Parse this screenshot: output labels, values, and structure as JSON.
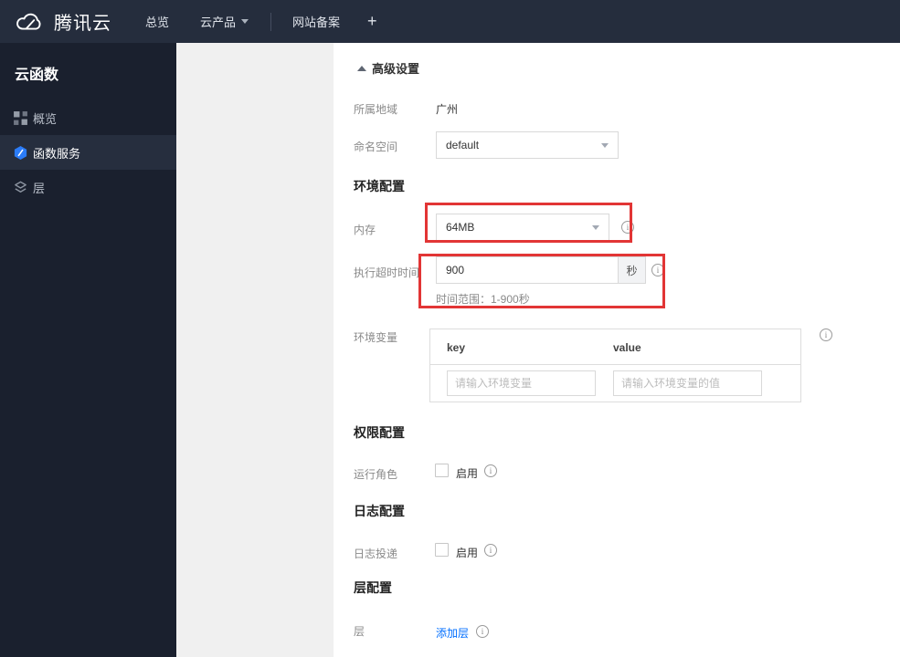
{
  "navbar": {
    "brand": "腾讯云",
    "menu": [
      {
        "label": "总览"
      },
      {
        "label": "云产品"
      },
      {
        "label": "网站备案"
      },
      {
        "label": "+"
      }
    ]
  },
  "sidebar": {
    "title": "云函数",
    "items": [
      {
        "label": "概览",
        "icon": "grid-icon",
        "active": false
      },
      {
        "label": "函数服务",
        "icon": "hexagon-function-icon",
        "active": true
      },
      {
        "label": "层",
        "icon": "layers-icon",
        "active": false
      }
    ]
  },
  "content": {
    "advanced_settings": "高级设置",
    "region_label": "所属地域",
    "region_value": "广州",
    "namespace_label": "命名空间",
    "namespace_value": "default",
    "section_env": "环境配置",
    "memory_label": "内存",
    "memory_value": "64MB",
    "timeout_label": "执行超时时间",
    "timeout_value": "900",
    "timeout_unit": "秒",
    "timeout_hint": "时间范围：1-900秒",
    "envvar_label": "环境变量",
    "envvar_key_header": "key",
    "envvar_value_header": "value",
    "envvar_key_placeholder": "请输入环境变量",
    "envvar_value_placeholder": "请输入环境变量的值",
    "section_permission": "权限配置",
    "role_label": "运行角色",
    "role_enable_label": "启用",
    "role_enabled": false,
    "section_log": "日志配置",
    "logship_label": "日志投递",
    "log_enable_label": "启用",
    "log_enabled": false,
    "section_layer": "层配置",
    "layer_label": "层",
    "add_layer_link": "添加层"
  },
  "colors": {
    "navbar_bg": "#252d3d",
    "sidebar_bg": "#1a202e",
    "sidebar_active_bg": "#262e3e",
    "secondary_panel_bg": "#f0f0f0",
    "accent_blue": "#006eff",
    "scf_icon_blue": "#2b7cf8",
    "annotation_red": "#e23535"
  }
}
